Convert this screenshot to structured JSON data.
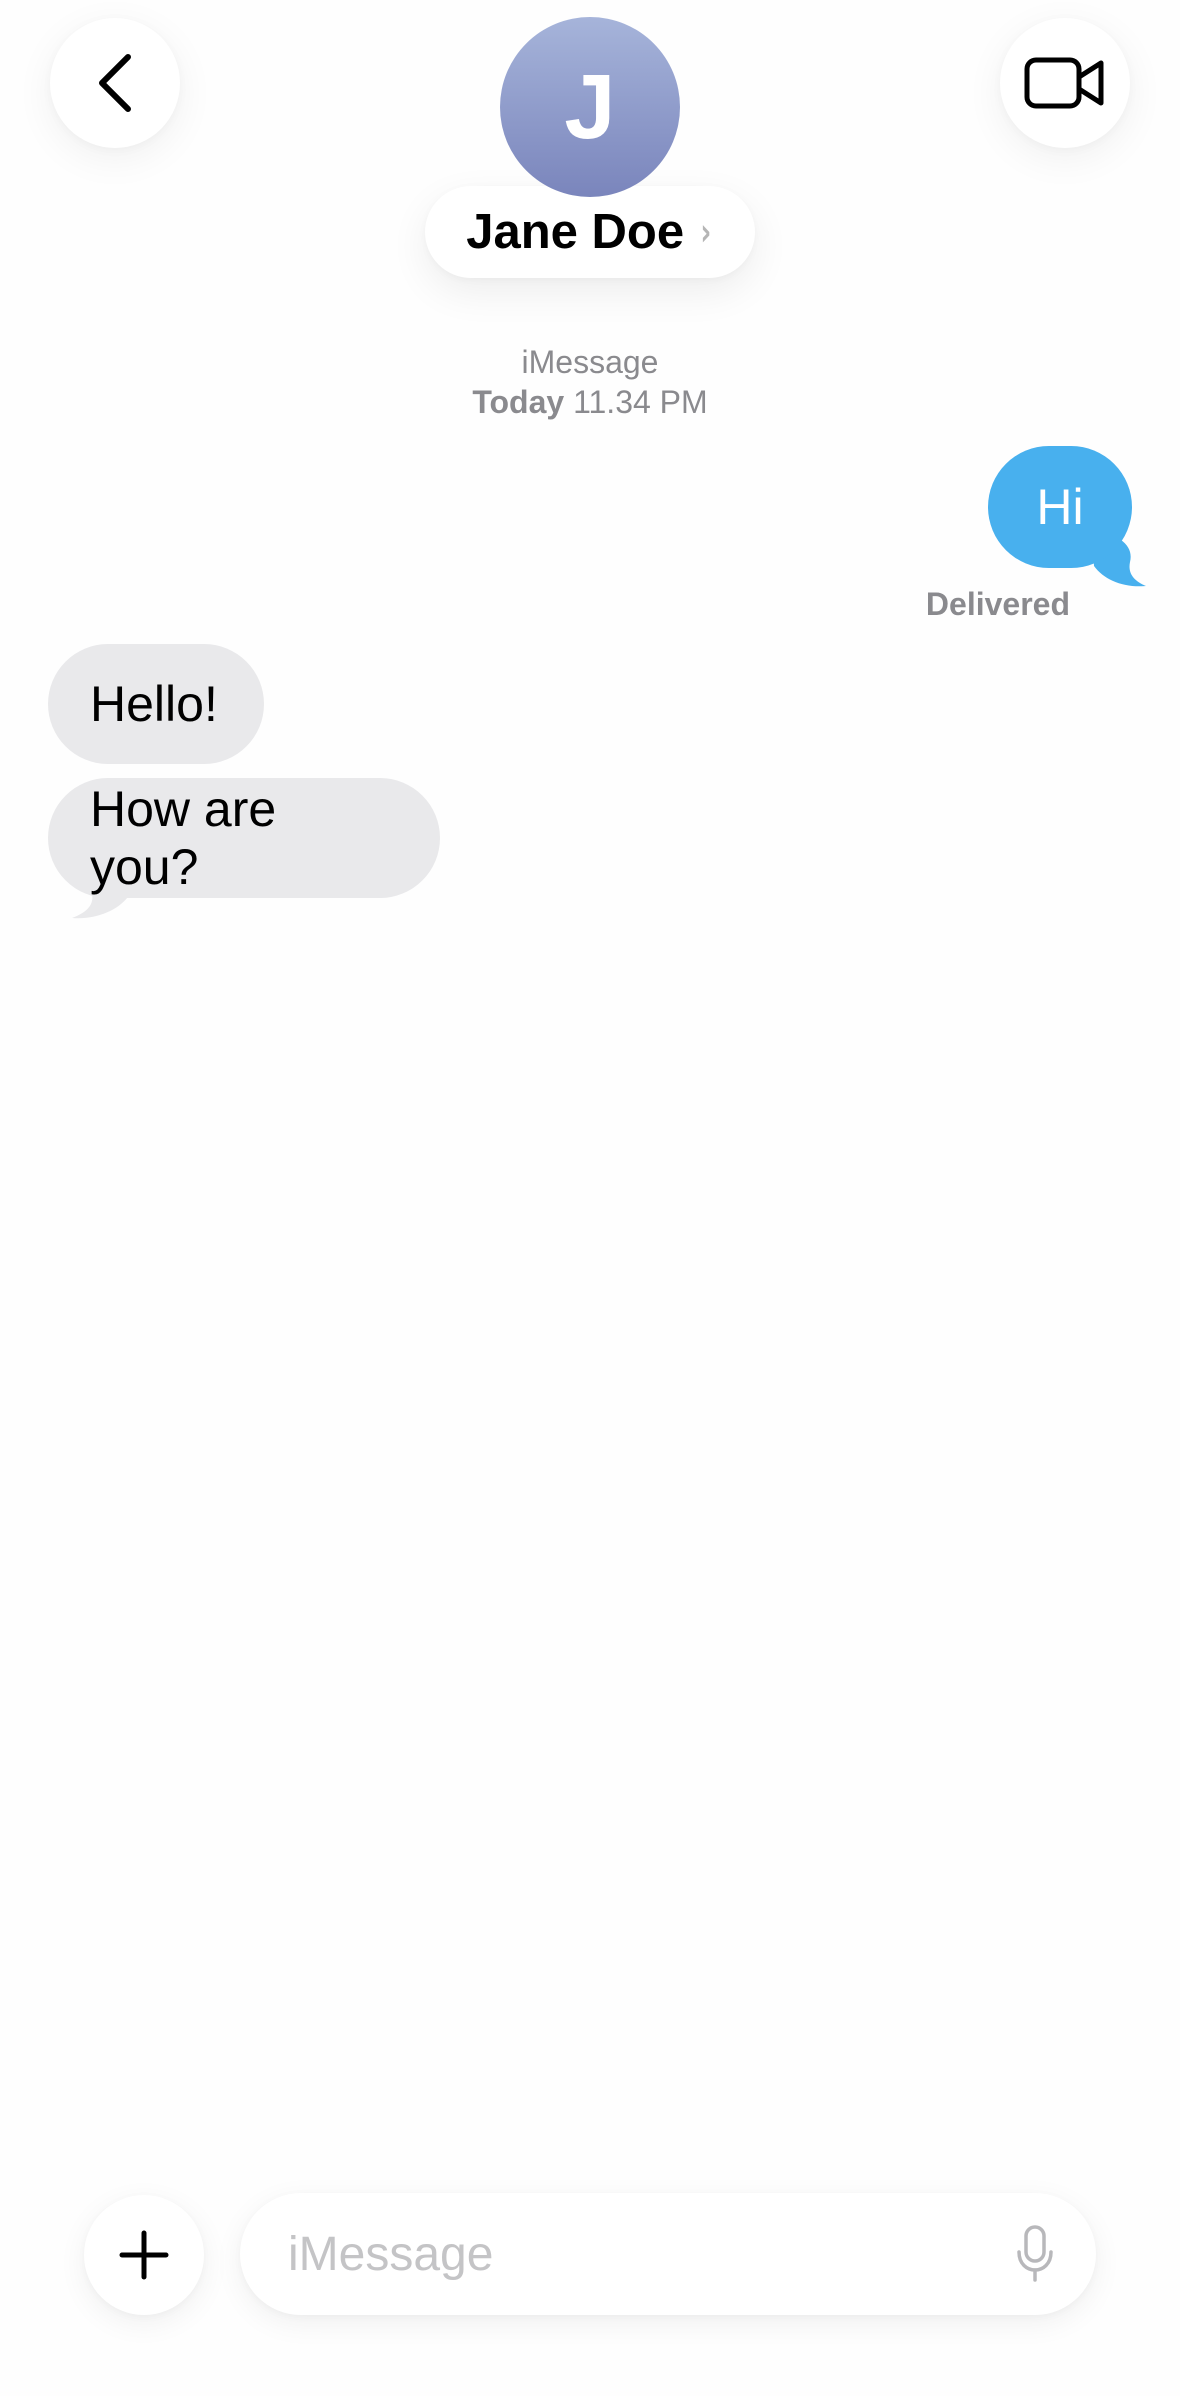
{
  "header": {
    "avatar_initial": "J",
    "contact_name": "Jane Doe",
    "contact_chevron": "›",
    "back_icon": "chevron-left-icon",
    "video_icon": "video-camera-icon"
  },
  "conversation": {
    "service": "iMessage",
    "time_day": "Today",
    "time_value": "11.34 PM",
    "messages": [
      {
        "direction": "outgoing",
        "text": "Hi"
      },
      {
        "direction": "incoming",
        "text": "Hello!"
      },
      {
        "direction": "incoming",
        "text": "How are you?"
      }
    ],
    "delivery_status": "Delivered"
  },
  "composer": {
    "placeholder": "iMessage",
    "plus_icon": "plus-icon",
    "mic_icon": "microphone-icon"
  },
  "colors": {
    "outgoing_bubble": "#48b0ee",
    "incoming_bubble": "#e9e9eb",
    "avatar_gradient_top": "#a6b4da",
    "avatar_gradient_bottom": "#7a85bc",
    "meta_text": "#8a8a8e"
  }
}
